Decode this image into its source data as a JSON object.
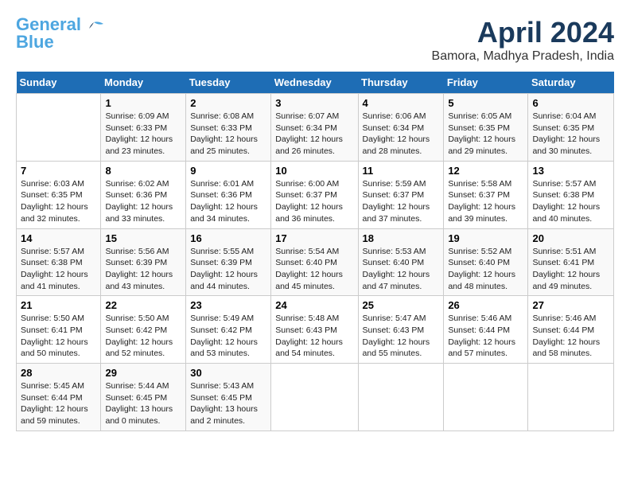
{
  "header": {
    "logo_line1": "General",
    "logo_line2": "Blue",
    "month_title": "April 2024",
    "location": "Bamora, Madhya Pradesh, India"
  },
  "calendar": {
    "days_of_week": [
      "Sunday",
      "Monday",
      "Tuesday",
      "Wednesday",
      "Thursday",
      "Friday",
      "Saturday"
    ],
    "weeks": [
      [
        {
          "day": "",
          "info": ""
        },
        {
          "day": "1",
          "info": "Sunrise: 6:09 AM\nSunset: 6:33 PM\nDaylight: 12 hours\nand 23 minutes."
        },
        {
          "day": "2",
          "info": "Sunrise: 6:08 AM\nSunset: 6:33 PM\nDaylight: 12 hours\nand 25 minutes."
        },
        {
          "day": "3",
          "info": "Sunrise: 6:07 AM\nSunset: 6:34 PM\nDaylight: 12 hours\nand 26 minutes."
        },
        {
          "day": "4",
          "info": "Sunrise: 6:06 AM\nSunset: 6:34 PM\nDaylight: 12 hours\nand 28 minutes."
        },
        {
          "day": "5",
          "info": "Sunrise: 6:05 AM\nSunset: 6:35 PM\nDaylight: 12 hours\nand 29 minutes."
        },
        {
          "day": "6",
          "info": "Sunrise: 6:04 AM\nSunset: 6:35 PM\nDaylight: 12 hours\nand 30 minutes."
        }
      ],
      [
        {
          "day": "7",
          "info": "Sunrise: 6:03 AM\nSunset: 6:35 PM\nDaylight: 12 hours\nand 32 minutes."
        },
        {
          "day": "8",
          "info": "Sunrise: 6:02 AM\nSunset: 6:36 PM\nDaylight: 12 hours\nand 33 minutes."
        },
        {
          "day": "9",
          "info": "Sunrise: 6:01 AM\nSunset: 6:36 PM\nDaylight: 12 hours\nand 34 minutes."
        },
        {
          "day": "10",
          "info": "Sunrise: 6:00 AM\nSunset: 6:37 PM\nDaylight: 12 hours\nand 36 minutes."
        },
        {
          "day": "11",
          "info": "Sunrise: 5:59 AM\nSunset: 6:37 PM\nDaylight: 12 hours\nand 37 minutes."
        },
        {
          "day": "12",
          "info": "Sunrise: 5:58 AM\nSunset: 6:37 PM\nDaylight: 12 hours\nand 39 minutes."
        },
        {
          "day": "13",
          "info": "Sunrise: 5:57 AM\nSunset: 6:38 PM\nDaylight: 12 hours\nand 40 minutes."
        }
      ],
      [
        {
          "day": "14",
          "info": "Sunrise: 5:57 AM\nSunset: 6:38 PM\nDaylight: 12 hours\nand 41 minutes."
        },
        {
          "day": "15",
          "info": "Sunrise: 5:56 AM\nSunset: 6:39 PM\nDaylight: 12 hours\nand 43 minutes."
        },
        {
          "day": "16",
          "info": "Sunrise: 5:55 AM\nSunset: 6:39 PM\nDaylight: 12 hours\nand 44 minutes."
        },
        {
          "day": "17",
          "info": "Sunrise: 5:54 AM\nSunset: 6:40 PM\nDaylight: 12 hours\nand 45 minutes."
        },
        {
          "day": "18",
          "info": "Sunrise: 5:53 AM\nSunset: 6:40 PM\nDaylight: 12 hours\nand 47 minutes."
        },
        {
          "day": "19",
          "info": "Sunrise: 5:52 AM\nSunset: 6:40 PM\nDaylight: 12 hours\nand 48 minutes."
        },
        {
          "day": "20",
          "info": "Sunrise: 5:51 AM\nSunset: 6:41 PM\nDaylight: 12 hours\nand 49 minutes."
        }
      ],
      [
        {
          "day": "21",
          "info": "Sunrise: 5:50 AM\nSunset: 6:41 PM\nDaylight: 12 hours\nand 50 minutes."
        },
        {
          "day": "22",
          "info": "Sunrise: 5:50 AM\nSunset: 6:42 PM\nDaylight: 12 hours\nand 52 minutes."
        },
        {
          "day": "23",
          "info": "Sunrise: 5:49 AM\nSunset: 6:42 PM\nDaylight: 12 hours\nand 53 minutes."
        },
        {
          "day": "24",
          "info": "Sunrise: 5:48 AM\nSunset: 6:43 PM\nDaylight: 12 hours\nand 54 minutes."
        },
        {
          "day": "25",
          "info": "Sunrise: 5:47 AM\nSunset: 6:43 PM\nDaylight: 12 hours\nand 55 minutes."
        },
        {
          "day": "26",
          "info": "Sunrise: 5:46 AM\nSunset: 6:44 PM\nDaylight: 12 hours\nand 57 minutes."
        },
        {
          "day": "27",
          "info": "Sunrise: 5:46 AM\nSunset: 6:44 PM\nDaylight: 12 hours\nand 58 minutes."
        }
      ],
      [
        {
          "day": "28",
          "info": "Sunrise: 5:45 AM\nSunset: 6:44 PM\nDaylight: 12 hours\nand 59 minutes."
        },
        {
          "day": "29",
          "info": "Sunrise: 5:44 AM\nSunset: 6:45 PM\nDaylight: 13 hours\nand 0 minutes."
        },
        {
          "day": "30",
          "info": "Sunrise: 5:43 AM\nSunset: 6:45 PM\nDaylight: 13 hours\nand 2 minutes."
        },
        {
          "day": "",
          "info": ""
        },
        {
          "day": "",
          "info": ""
        },
        {
          "day": "",
          "info": ""
        },
        {
          "day": "",
          "info": ""
        }
      ]
    ]
  }
}
